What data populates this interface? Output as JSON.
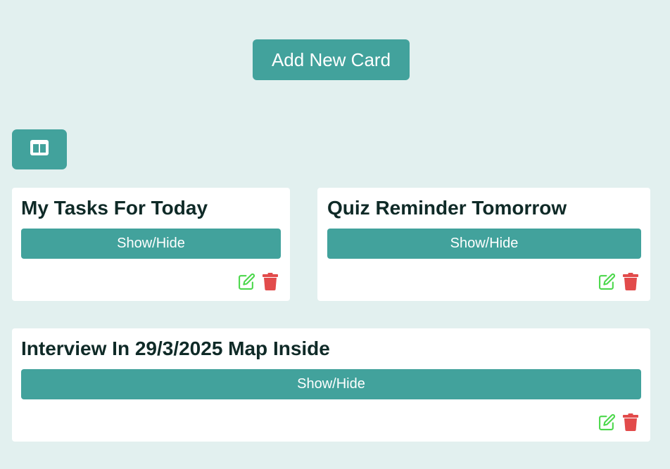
{
  "header": {
    "add_card_label": "Add New Card"
  },
  "toolbar": {
    "layout_toggle_icon": "columns-icon"
  },
  "cards": [
    {
      "title": "My Tasks For Today",
      "toggle_label": "Show/Hide",
      "edit_icon": "edit-icon",
      "delete_icon": "trash-icon"
    },
    {
      "title": "Quiz Reminder Tomorrow",
      "toggle_label": "Show/Hide",
      "edit_icon": "edit-icon",
      "delete_icon": "trash-icon"
    },
    {
      "title": "Interview In 29/3/2025 Map Inside",
      "toggle_label": "Show/Hide",
      "edit_icon": "edit-icon",
      "delete_icon": "trash-icon"
    }
  ],
  "colors": {
    "background": "#e2f0ef",
    "accent": "#42a29c",
    "edit": "#4cd84c",
    "delete": "#e24b4b",
    "title_text": "#0f2a27"
  }
}
